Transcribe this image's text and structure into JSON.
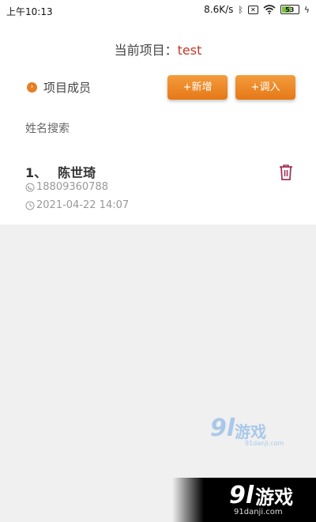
{
  "status_bar": {
    "time": "上午10:13",
    "net_speed": "8.6K/s",
    "battery_level": "53",
    "icons": [
      "bluetooth-icon",
      "sim-off-icon",
      "wifi-icon",
      "battery-icon",
      "charging-icon"
    ]
  },
  "project": {
    "label": "当前项目：",
    "name": "test"
  },
  "members_section": {
    "title": "项目成员",
    "add_button": "+新增",
    "transfer_button": "+调入"
  },
  "search": {
    "placeholder": "姓名搜索"
  },
  "members": [
    {
      "index": "1、",
      "name": "陈世琦",
      "phone": "18809360788",
      "date": "2021-04-22 14:07"
    }
  ],
  "watermark": {
    "num": "9l",
    "text": "游戏",
    "site": "91danji.com"
  },
  "colors": {
    "accent": "#e67e22",
    "project_name": "#c0392b",
    "delete_icon": "#a0345a",
    "background": "#f0f0f0"
  }
}
